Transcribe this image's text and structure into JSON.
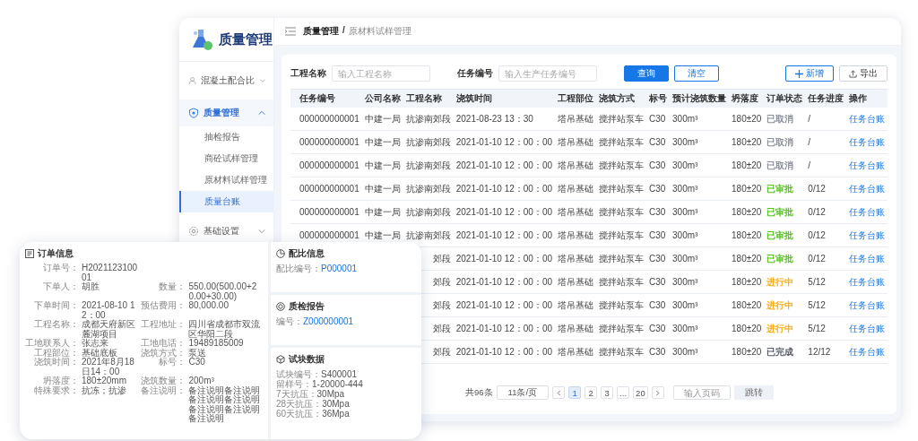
{
  "sidebar": {
    "logo_title": "质量管理",
    "items": [
      {
        "label": "混凝土配合比",
        "active": false,
        "expanded": false
      },
      {
        "label": "质量管理",
        "active": true,
        "expanded": true,
        "children": [
          {
            "label": "抽检报告",
            "selected": false
          },
          {
            "label": "商砼试样管理",
            "selected": false
          },
          {
            "label": "原材料试样管理",
            "selected": false
          },
          {
            "label": "质量台账",
            "selected": true
          }
        ]
      },
      {
        "label": "基础设置",
        "active": false,
        "expanded": false
      }
    ]
  },
  "breadcrumb": {
    "items": [
      "质量管理",
      "原材料试样管理"
    ],
    "separator": "/"
  },
  "filters": [
    {
      "label": "工程名称",
      "placeholder": "输入工程名称"
    },
    {
      "label": "任务编号",
      "placeholder": "输入生产任务编号"
    }
  ],
  "actions": [
    {
      "label": "查询",
      "kind": "primary"
    },
    {
      "label": "清空",
      "kind": "outline"
    },
    {
      "label": "新增",
      "kind": "add"
    },
    {
      "label": "导出",
      "kind": "export"
    }
  ],
  "table": {
    "columns": [
      "任务编号",
      "公司名称",
      "工程名称",
      "浇筑时间",
      "工程部位",
      "浇筑方式",
      "标号",
      "预计浇筑数量",
      "坍落度",
      "订单状态",
      "任务进度",
      "操作"
    ],
    "rows": [
      {
        "color": "#8a8f99",
        "cells": [
          "000000000001",
          "中建一局",
          "抗渗南郊段",
          "2021-08-23 13：30",
          "塔吊基础",
          "搅拌站泵车",
          "C30",
          "300m³",
          "180±20",
          "已取消",
          "/",
          "任务台账"
        ]
      },
      {
        "color": "#8a8f99",
        "cells": [
          "000000000001",
          "中建一局",
          "抗渗南郊段",
          "2021-01-10 12：00：00",
          "塔吊基础",
          "搅拌站泵车",
          "C30",
          "300m³",
          "180±20",
          "已取消",
          "/",
          "任务台账"
        ]
      },
      {
        "color": "#8a8f99",
        "cells": [
          "000000000001",
          "中建一局",
          "抗渗南郊段",
          "2021-01-10 12：00：00",
          "塔吊基础",
          "搅拌站泵车",
          "C30",
          "300m³",
          "180±20",
          "已取消",
          "/",
          "任务台账"
        ]
      },
      {
        "color": "#52c41a",
        "cells": [
          "000000000001",
          "中建一局",
          "抗渗南郊段",
          "2021-01-10 12：00：00",
          "塔吊基础",
          "搅拌站泵车",
          "C30",
          "300m³",
          "180±20",
          "已审批",
          "0/12",
          "任务台账"
        ]
      },
      {
        "color": "#52c41a",
        "cells": [
          "000000000001",
          "中建一局",
          "抗渗南郊段",
          "2021-01-10 12：00：00",
          "塔吊基础",
          "搅拌站泵车",
          "C30",
          "300m³",
          "180±20",
          "已审批",
          "0/12",
          "任务台账"
        ]
      },
      {
        "color": "#52c41a",
        "cells": [
          "000000000001",
          "中建一局",
          "抗渗南郊段",
          "2021-01-10 12：00：00",
          "塔吊基础",
          "搅拌站泵车",
          "C30",
          "300m³",
          "180±20",
          "已审批",
          "0/12",
          "任务台账"
        ]
      },
      {
        "color": "#52c41a",
        "cells": [
          null,
          null,
          "郊段",
          "2021-01-10 12：00：00",
          "塔吊基础",
          "搅拌站泵车",
          "C30",
          "300m³",
          "180±20",
          "已审批",
          "0/12",
          "任务台账"
        ]
      },
      {
        "color": "#faad14",
        "cells": [
          null,
          null,
          "郊段",
          "2021-01-10 12：00：00",
          "塔吊基础",
          "搅拌站泵车",
          "C30",
          "300m³",
          "180±20",
          "进行中",
          "5/12",
          "任务台账"
        ]
      },
      {
        "color": "#faad14",
        "cells": [
          null,
          null,
          "郊段",
          "2021-01-10 12：00：00",
          "塔吊基础",
          "搅拌站泵车",
          "C30",
          "300m³",
          "180±20",
          "进行中",
          "5/12",
          "任务台账"
        ]
      },
      {
        "color": "#faad14",
        "cells": [
          null,
          null,
          "郊段",
          "2021-01-10 12：00：00",
          "塔吊基础",
          "搅拌站泵车",
          "C30",
          "300m³",
          "180±20",
          "进行中",
          "5/12",
          "任务台账"
        ]
      },
      {
        "color": "#555a63",
        "cells": [
          null,
          null,
          "郊段",
          "2021-01-10 12：00：00",
          "塔吊基础",
          "搅拌站泵车",
          "C30",
          "300m³",
          "180±20",
          "已完成",
          "12/12",
          "任务台账"
        ]
      }
    ]
  },
  "pagination": {
    "total": "共96条",
    "page_size": "11条/页",
    "pages": [
      {
        "label": "1",
        "selected": true
      },
      {
        "label": "2",
        "selected": false
      },
      {
        "label": "3",
        "selected": false
      },
      {
        "label": "...",
        "selected": false
      },
      {
        "label": "20",
        "selected": false
      }
    ],
    "jump_placeholder": "输入页码",
    "jump_button": "跳转"
  },
  "order_card": {
    "title": "订单信息",
    "rows": [
      [
        {
          "label": "订单号：",
          "value": "H202112310001"
        }
      ],
      [
        {
          "label": "下单人：",
          "value": "胡胜"
        },
        {
          "label": "数量：",
          "value": "550.00(500.00+20.00+30.00)"
        }
      ],
      [
        {
          "label": "下单时间：",
          "value": "2021-08-10 12：00"
        },
        {
          "label": "预估费用：",
          "value": "80,000.00"
        }
      ],
      [
        {
          "label": "工程名称：",
          "value": "成都天府新区麓湖项目"
        },
        {
          "label": "工程地址：",
          "value": "四川省成都市双流区华阳二段"
        }
      ],
      [
        {
          "label": "工地联系人：",
          "value": "张志来"
        },
        {
          "label": "工地电话：",
          "value": "19489185009"
        }
      ],
      [
        {
          "label": "工程部位：",
          "value": "基础底板"
        },
        {
          "label": "浇筑方式：",
          "value": "泵送"
        }
      ],
      [
        {
          "label": "浇筑时间：",
          "value": "2021年8月18日14：00"
        },
        {
          "label": "标号：",
          "value": "C30"
        }
      ],
      [
        {
          "label": "坍落度：",
          "value": "180±20mm"
        },
        {
          "label": "浇筑数量：",
          "value": "200m³"
        }
      ],
      [
        {
          "label": "特殊要求：",
          "value": "抗冻；抗渗"
        },
        {
          "label": "备注说明：",
          "value": "备注说明备注说明备注说明备注说明备注说明备注说明备注说明"
        }
      ]
    ]
  },
  "panels": [
    {
      "title": "配比信息",
      "fields": [
        {
          "label": "配比编号：",
          "value": "P000001",
          "kind": "link"
        }
      ]
    },
    {
      "title": "质检报告",
      "fields": [
        {
          "label": "编号：",
          "value": "Z000000001",
          "kind": "link"
        }
      ]
    },
    {
      "title": "试块数据",
      "fields": [
        {
          "label": "试块编号：",
          "value": "S400001",
          "kind": "text"
        },
        {
          "label": "留样号：",
          "value": "1-20000-444",
          "kind": "text"
        },
        {
          "label": "7天抗压：",
          "value": "30Mpa",
          "kind": "text"
        },
        {
          "label": "28天抗压：",
          "value": "30Mpa",
          "kind": "text"
        },
        {
          "label": "60天抗压：",
          "value": "36Mpa",
          "kind": "text"
        }
      ]
    }
  ]
}
